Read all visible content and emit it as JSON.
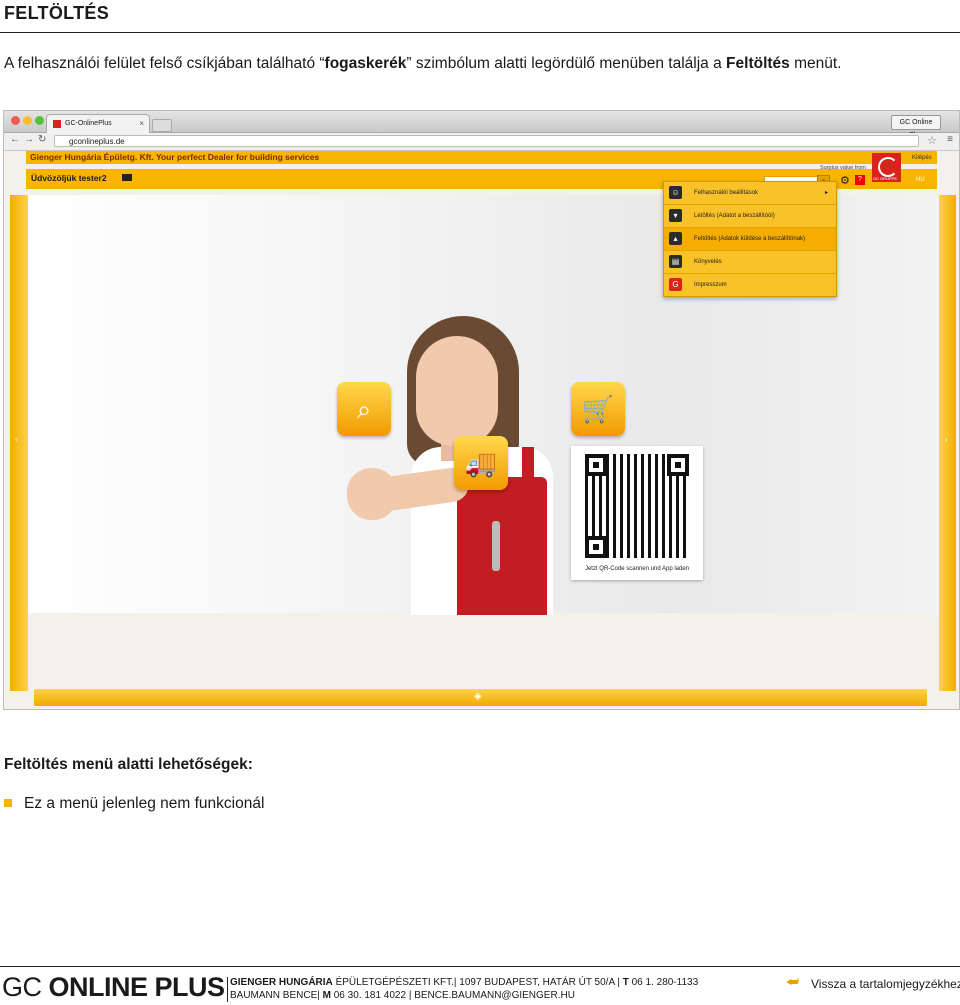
{
  "page": {
    "title": "FELTÖLTÉS",
    "intro": {
      "part1": "A felhasználói felület felső csíkjában található “",
      "bold1": "fogaskerék",
      "part2": "” szimbólum alatti legördülő menüben találja a ",
      "bold2": "Feltöltés",
      "part3": " menüt."
    },
    "section_heading": "Feltöltés menü alatti lehetőségek:",
    "bullet": "Ez a menü jelenleg nem funkcionál"
  },
  "browser": {
    "tab_title": "GC-OnlinePlus",
    "tab_close": "×",
    "profile": "GC Online Plus",
    "url": "gconlineplus.de"
  },
  "app": {
    "banner": "Gienger Hungária Épületg. Kft.  Your perfect Dealer for building services",
    "welcome": "Üdvözöljük tester2",
    "surplus": "Surplus value from",
    "logout": "Kilépés",
    "lang": "HU",
    "logo_text": "GC GRUPPE",
    "qr_caption": "Jetzt QR-Code scannen und App laden",
    "menu": [
      {
        "label": "Felhasználói beállítások",
        "icon": "user-settings-icon",
        "color": "#2b2b2b"
      },
      {
        "label": "Letöltés (Adatot a beszállítóól)",
        "icon": "download-icon",
        "color": "#2b2b2b"
      },
      {
        "label": "Feltöltés (Adatok küldése a beszállítónak)",
        "icon": "upload-icon",
        "color": "#2b2b2b"
      },
      {
        "label": "Könyvelés",
        "icon": "accounting-icon",
        "color": "#2b2b2b"
      },
      {
        "label": "Impresszum",
        "icon": "imprint-icon",
        "color": "#d7251d"
      }
    ]
  },
  "footer": {
    "brand_light": "GC ",
    "brand_bold": "ONLINE PLUS",
    "line1_bold": "GIENGER HUNGÁRIA",
    "line1_rest": " ÉPÜLETGÉPÉSZETI KFT.| 1097 BUDAPEST, HATÁR ÚT 50/A | ",
    "line1_t": "T",
    "line1_phone": " 06 1. 280-1133",
    "line2_name": "BAUMANN BENCE| ",
    "line2_m": "M",
    "line2_rest": " 06 30. 181 4022 | BENCE.BAUMANN@GIENGER.HU",
    "back_link": "Vissza a tartalomjegyzékhez"
  },
  "colors": {
    "accent": "#f7b500",
    "brand_red": "#d7251d"
  }
}
